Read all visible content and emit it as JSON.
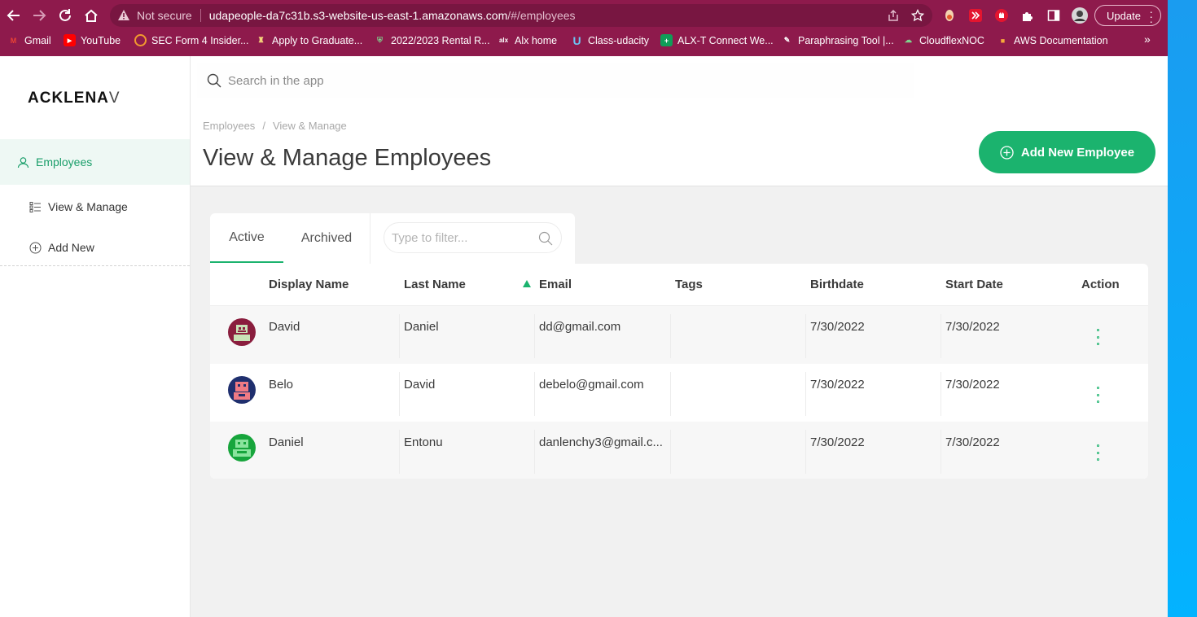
{
  "browser": {
    "not_secure": "Not secure",
    "url_host": "udapeople-da7c31b.s3-website-us-east-1.amazonaws.com",
    "url_path": "/#/employees",
    "update_label": "Update",
    "bookmarks": [
      {
        "label": "Gmail",
        "icon": "gmail-icon"
      },
      {
        "label": "YouTube",
        "icon": "youtube-icon"
      },
      {
        "label": "SEC Form 4 Insider...",
        "icon": "sec-icon"
      },
      {
        "label": "Apply to Graduate...",
        "icon": "school-icon"
      },
      {
        "label": "2022/2023 Rental R...",
        "icon": "crest-icon"
      },
      {
        "label": "Alx home",
        "icon": "alx-icon"
      },
      {
        "label": "Class-udacity",
        "icon": "udacity-icon"
      },
      {
        "label": "ALX-T Connect We...",
        "icon": "sheets-icon"
      },
      {
        "label": "Paraphrasing Tool |...",
        "icon": "quill-icon"
      },
      {
        "label": "CloudflexNOC",
        "icon": "cloudflex-icon"
      },
      {
        "label": "AWS Documentation",
        "icon": "aws-icon"
      }
    ],
    "more_label": "»"
  },
  "sidebar": {
    "logo_bold": "ACKLENA",
    "logo_fade": "V",
    "items": [
      {
        "label": "Employees",
        "icon": "user-icon"
      },
      {
        "label": "View & Manage",
        "icon": "list-icon"
      },
      {
        "label": "Add New",
        "icon": "plus-circle-icon"
      }
    ]
  },
  "topbar": {
    "search_placeholder": "Search in the app"
  },
  "header": {
    "breadcrumb": [
      "Employees",
      "View & Manage"
    ],
    "breadcrumb_sep": "/",
    "title": "View & Manage Employees",
    "add_button": "Add New Employee"
  },
  "tabs": {
    "active": "Active",
    "archived": "Archived",
    "filter_placeholder": "Type to filter..."
  },
  "table": {
    "columns": [
      "Display Name",
      "Last Name",
      "Email",
      "Tags",
      "Birthdate",
      "Start Date",
      "Action"
    ],
    "sorted_column": "Email",
    "rows": [
      {
        "display_name": "David",
        "last_name": "Daniel",
        "email": "dd@gmail.com",
        "tags": "",
        "birthdate": "7/30/2022",
        "start_date": "7/30/2022",
        "avatar_color": "#8a1e3e"
      },
      {
        "display_name": "Belo",
        "last_name": "David",
        "email": "debelo@gmail.com",
        "tags": "",
        "birthdate": "7/30/2022",
        "start_date": "7/30/2022",
        "avatar_color": "#1f2f6e"
      },
      {
        "display_name": "Daniel",
        "last_name": "Entonu",
        "email": "danlenchy3@gmail.c...",
        "tags": "",
        "birthdate": "7/30/2022",
        "start_date": "7/30/2022",
        "avatar_color": "#17a53c"
      }
    ]
  },
  "colors": {
    "chrome": "#8e1a4c",
    "accent": "#1bb36e",
    "active_bg": "#eef8f4"
  }
}
